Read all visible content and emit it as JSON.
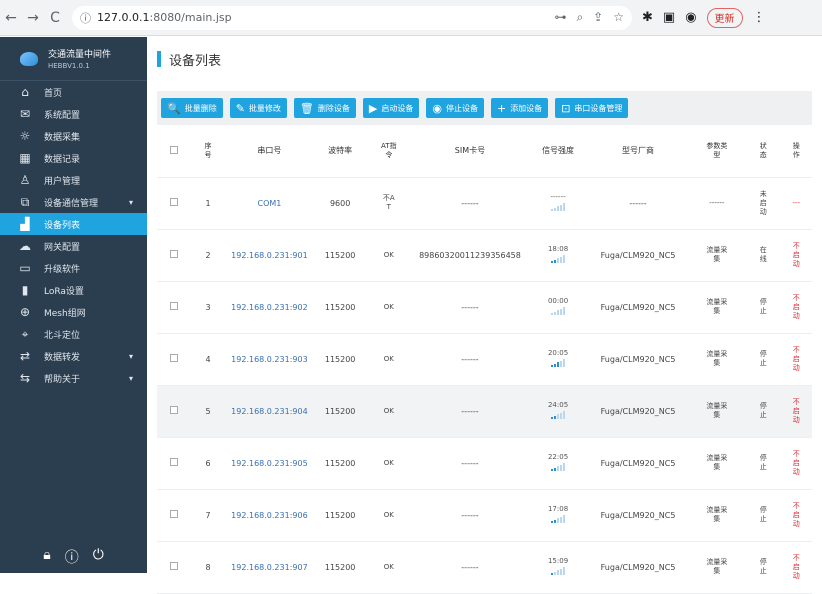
{
  "browser": {
    "url_host": "127.0.0.1",
    "url_path": ":8080/main.jsp",
    "profile_label": "更新"
  },
  "sidebar": {
    "brand_title": "交通流量中间件",
    "brand_version": "HEBBV1.0.1",
    "items": [
      {
        "label": "首页",
        "icon": "home-icon",
        "glyph": "⌂"
      },
      {
        "label": "系统配置",
        "icon": "mail-icon",
        "glyph": "✉"
      },
      {
        "label": "数据采集",
        "icon": "sun-icon",
        "glyph": "☼"
      },
      {
        "label": "数据记录",
        "icon": "grid-icon",
        "glyph": "▦"
      },
      {
        "label": "用户管理",
        "icon": "user-icon",
        "glyph": "♙"
      },
      {
        "label": "设备通信管理",
        "icon": "device-icon",
        "glyph": "⧉"
      },
      {
        "label": "设备列表",
        "icon": "building-icon",
        "glyph": "▟"
      },
      {
        "label": "网关配置",
        "icon": "cloud-icon",
        "glyph": "☁"
      },
      {
        "label": "升级软件",
        "icon": "monitor-icon",
        "glyph": "▭"
      },
      {
        "label": "LoRa设置",
        "icon": "signal-icon",
        "glyph": "▮"
      },
      {
        "label": "Mesh组网",
        "icon": "globe-icon",
        "glyph": "⊕"
      },
      {
        "label": "北斗定位",
        "icon": "map-icon",
        "glyph": "⌖"
      },
      {
        "label": "数据转发",
        "icon": "forward-icon",
        "glyph": "⇄"
      },
      {
        "label": "帮助关于",
        "icon": "help-icon",
        "glyph": "⇆"
      }
    ]
  },
  "main": {
    "title": "设备列表",
    "toolbar": [
      {
        "label": "批量删除",
        "glyph": "🔍"
      },
      {
        "label": "批量修改",
        "glyph": "✎"
      },
      {
        "label": "删除设备",
        "glyph": "🗑"
      },
      {
        "label": "启动设备",
        "glyph": "▶"
      },
      {
        "label": "停止设备",
        "glyph": "◉"
      },
      {
        "label": "添加设备",
        "glyph": "+"
      },
      {
        "label": "串口设备管理",
        "glyph": "⊡"
      }
    ],
    "table": {
      "headers": [
        "序号",
        "串口号",
        "波特率",
        "AT指令",
        "SIM卡号",
        "信号强度",
        "型号厂商",
        "参数类型",
        "状态",
        "操作"
      ],
      "rows": [
        {
          "no": "1",
          "port": "COM1",
          "baud": "9600",
          "at": "不AT",
          "sim": "------",
          "time": "------",
          "bars": 0,
          "model": "------",
          "param": "------",
          "state": "未启动",
          "op": "---"
        },
        {
          "no": "2",
          "port": "192.168.0.231:901",
          "baud": "115200",
          "at": "OK",
          "sim": "89860320011239356458",
          "time": "18:08",
          "bars": 2,
          "model": "Fuga/CLM920_NC5",
          "param": "流量采集",
          "state": "在线",
          "op": "不启动"
        },
        {
          "no": "3",
          "port": "192.168.0.231:902",
          "baud": "115200",
          "at": "OK",
          "sim": "------",
          "time": "00:00",
          "bars": 0,
          "model": "Fuga/CLM920_NC5",
          "param": "流量采集",
          "state": "停止",
          "op": "不启动"
        },
        {
          "no": "4",
          "port": "192.168.0.231:903",
          "baud": "115200",
          "at": "OK",
          "sim": "------",
          "time": "20:05",
          "bars": 3,
          "model": "Fuga/CLM920_NC5",
          "param": "流量采集",
          "state": "停止",
          "op": "不启动"
        },
        {
          "no": "5",
          "port": "192.168.0.231:904",
          "baud": "115200",
          "at": "OK",
          "sim": "------",
          "time": "24:05",
          "bars": 2,
          "model": "Fuga/CLM920_NC5",
          "param": "流量采集",
          "state": "停止",
          "op": "不启动"
        },
        {
          "no": "6",
          "port": "192.168.0.231:905",
          "baud": "115200",
          "at": "OK",
          "sim": "------",
          "time": "22:05",
          "bars": 2,
          "model": "Fuga/CLM920_NC5",
          "param": "流量采集",
          "state": "停止",
          "op": "不启动"
        },
        {
          "no": "7",
          "port": "192.168.0.231:906",
          "baud": "115200",
          "at": "OK",
          "sim": "------",
          "time": "17:08",
          "bars": 2,
          "model": "Fuga/CLM920_NC5",
          "param": "流量采集",
          "state": "停止",
          "op": "不启动"
        },
        {
          "no": "8",
          "port": "192.168.0.231:907",
          "baud": "115200",
          "at": "OK",
          "sim": "------",
          "time": "15:09",
          "bars": 1,
          "model": "Fuga/CLM920_NC5",
          "param": "流量采集",
          "state": "停止",
          "op": "不启动"
        }
      ]
    }
  }
}
